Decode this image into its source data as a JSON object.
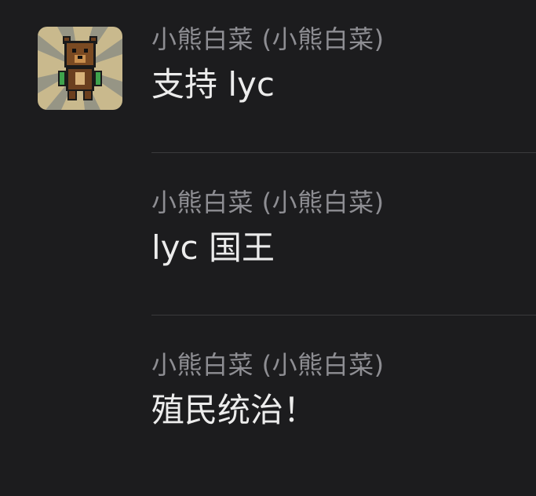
{
  "colors": {
    "background": "#1c1c1e",
    "sender_text": "#8e8e93",
    "message_text": "#ececec",
    "divider": "#3a3a3c"
  },
  "avatar": {
    "icon": "pixel-bear-icon"
  },
  "messages": [
    {
      "sender": "小熊白菜 (小熊白菜)",
      "text": "支持 lyc"
    },
    {
      "sender": "小熊白菜 (小熊白菜)",
      "text": "lyc 国王"
    },
    {
      "sender": "小熊白菜 (小熊白菜)",
      "text": "殖民统治！"
    }
  ]
}
